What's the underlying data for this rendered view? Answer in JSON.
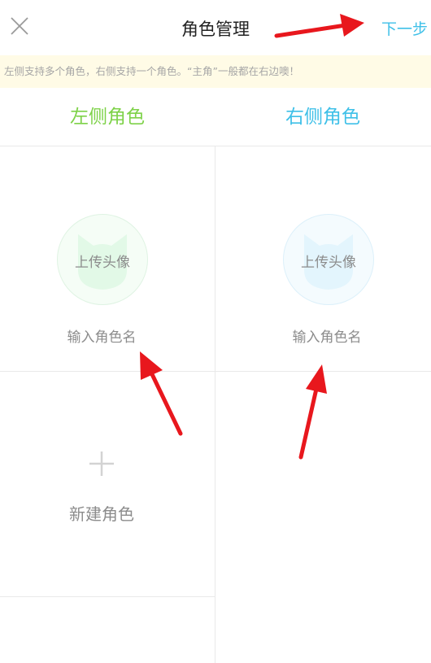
{
  "header": {
    "title": "角色管理",
    "next_label": "下一步",
    "close_icon": "close-icon"
  },
  "notice": {
    "text": "左侧支持多个角色，右侧支持一个角色。“主角”一般都在右边噢！"
  },
  "sides": {
    "left_title": "左侧角色",
    "right_title": "右侧角色"
  },
  "left_card": {
    "avatar_label": "上传头像",
    "name_placeholder": "输入角色名"
  },
  "right_card": {
    "avatar_label": "上传头像",
    "name_placeholder": "输入角色名"
  },
  "new_role": {
    "label": "新建角色",
    "icon": "plus-icon"
  },
  "colors": {
    "left_accent": "#7ed249",
    "right_accent": "#3fc0e8",
    "notice_bg": "#fffbe6",
    "annotation_arrow": "#e8171d"
  }
}
